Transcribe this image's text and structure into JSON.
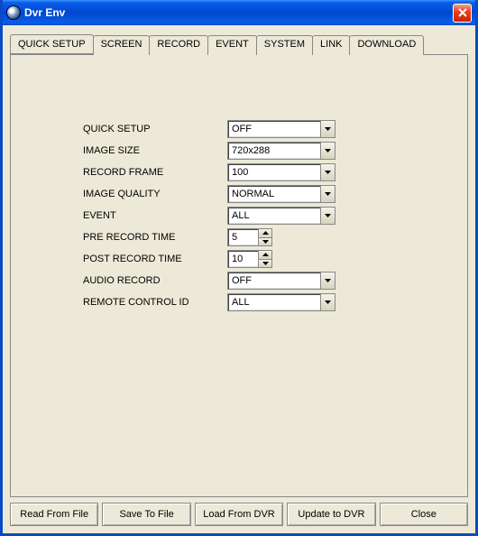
{
  "window": {
    "title": "Dvr Env"
  },
  "tabs": [
    {
      "label": "QUICK SETUP",
      "active": true
    },
    {
      "label": "SCREEN",
      "active": false
    },
    {
      "label": "RECORD",
      "active": false
    },
    {
      "label": "EVENT",
      "active": false
    },
    {
      "label": "SYSTEM",
      "active": false
    },
    {
      "label": "LINK",
      "active": false
    },
    {
      "label": "DOWNLOAD",
      "active": false
    }
  ],
  "form": {
    "quick_setup": {
      "label": "QUICK SETUP",
      "value": "OFF"
    },
    "image_size": {
      "label": "IMAGE SIZE",
      "value": "720x288"
    },
    "record_frame": {
      "label": "RECORD FRAME",
      "value": "100"
    },
    "image_quality": {
      "label": "IMAGE QUALITY",
      "value": "NORMAL"
    },
    "event": {
      "label": "EVENT",
      "value": "ALL"
    },
    "pre_record_time": {
      "label": "PRE RECORD TIME",
      "value": "5"
    },
    "post_record_time": {
      "label": "POST RECORD TIME",
      "value": "10"
    },
    "audio_record": {
      "label": "AUDIO RECORD",
      "value": "OFF"
    },
    "remote_control_id": {
      "label": "REMOTE CONTROL ID",
      "value": "ALL"
    }
  },
  "buttons": {
    "read_from_file": "Read From File",
    "save_to_file": "Save To File",
    "load_from_dvr": "Load From DVR",
    "update_to_dvr": "Update to DVR",
    "close": "Close"
  }
}
